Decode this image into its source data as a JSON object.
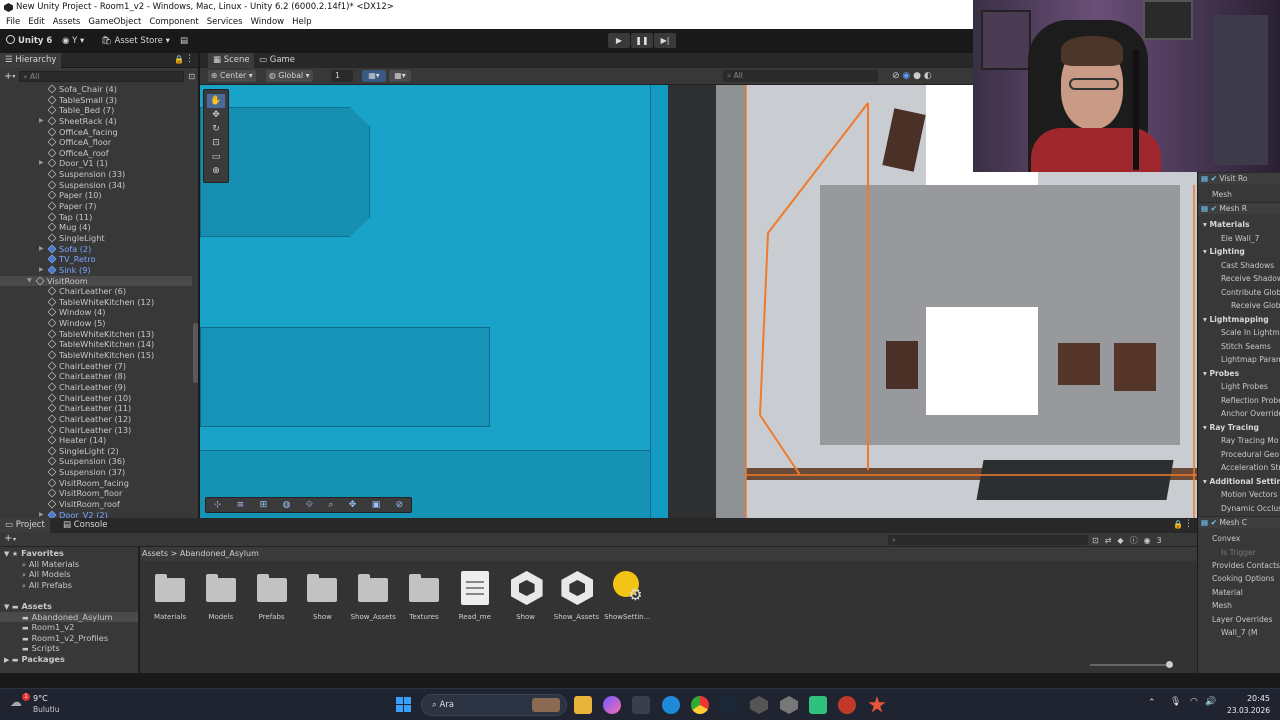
{
  "window": {
    "title": "New Unity Project - Room1_v2 - Windows, Mac, Linux - Unity 6.2 (6000.2.14f1)* <DX12>"
  },
  "menu": [
    "File",
    "Edit",
    "Assets",
    "GameObject",
    "Component",
    "Services",
    "Window",
    "Help"
  ],
  "toolbar": {
    "unity_label": "Unity 6",
    "account_label": "Y",
    "asset_store": "Asset Store",
    "play_icons": [
      "▶",
      "❚❚",
      "▶|"
    ]
  },
  "hierarchy": {
    "title": "Hierarchy",
    "search_placeholder": "All",
    "items": [
      {
        "label": "Sofa_Chair (4)",
        "indent": 1,
        "type": "obj"
      },
      {
        "label": "TableSmall (3)",
        "indent": 1,
        "type": "obj"
      },
      {
        "label": "Table_Bed (7)",
        "indent": 1,
        "type": "obj"
      },
      {
        "label": "SheetRack (4)",
        "indent": 1,
        "type": "obj",
        "arrow": true
      },
      {
        "label": "OfficeA_facing",
        "indent": 1,
        "type": "obj"
      },
      {
        "label": "OfficeA_floor",
        "indent": 1,
        "type": "obj"
      },
      {
        "label": "OfficeA_roof",
        "indent": 1,
        "type": "obj"
      },
      {
        "label": "Door_V1 (1)",
        "indent": 1,
        "type": "obj",
        "arrow": true
      },
      {
        "label": "Suspension (33)",
        "indent": 1,
        "type": "obj"
      },
      {
        "label": "Suspension (34)",
        "indent": 1,
        "type": "obj"
      },
      {
        "label": "Paper (10)",
        "indent": 1,
        "type": "obj"
      },
      {
        "label": "Paper (7)",
        "indent": 1,
        "type": "obj"
      },
      {
        "label": "Tap (11)",
        "indent": 1,
        "type": "obj"
      },
      {
        "label": "Mug (4)",
        "indent": 1,
        "type": "obj"
      },
      {
        "label": "SingleLight",
        "indent": 1,
        "type": "obj"
      },
      {
        "label": "Sofa (2)",
        "indent": 1,
        "type": "prefab",
        "arrow": true
      },
      {
        "label": "TV_Retro",
        "indent": 1,
        "type": "prefab"
      },
      {
        "label": "Sink (9)",
        "indent": 1,
        "type": "prefab",
        "arrow": true
      },
      {
        "label": "VisitRoom",
        "indent": 0,
        "type": "obj",
        "arrow": true,
        "selected": true
      },
      {
        "label": "ChairLeather (6)",
        "indent": 1,
        "type": "obj"
      },
      {
        "label": "TableWhiteKitchen (12)",
        "indent": 1,
        "type": "obj"
      },
      {
        "label": "Window (4)",
        "indent": 1,
        "type": "obj"
      },
      {
        "label": "Window (5)",
        "indent": 1,
        "type": "obj"
      },
      {
        "label": "TableWhiteKitchen (13)",
        "indent": 1,
        "type": "obj"
      },
      {
        "label": "TableWhiteKitchen (14)",
        "indent": 1,
        "type": "obj"
      },
      {
        "label": "TableWhiteKitchen (15)",
        "indent": 1,
        "type": "obj"
      },
      {
        "label": "ChairLeather (7)",
        "indent": 1,
        "type": "obj"
      },
      {
        "label": "ChairLeather (8)",
        "indent": 1,
        "type": "obj"
      },
      {
        "label": "ChairLeather (9)",
        "indent": 1,
        "type": "obj"
      },
      {
        "label": "ChairLeather (10)",
        "indent": 1,
        "type": "obj"
      },
      {
        "label": "ChairLeather (11)",
        "indent": 1,
        "type": "obj"
      },
      {
        "label": "ChairLeather (12)",
        "indent": 1,
        "type": "obj"
      },
      {
        "label": "ChairLeather (13)",
        "indent": 1,
        "type": "obj"
      },
      {
        "label": "Heater (14)",
        "indent": 1,
        "type": "obj"
      },
      {
        "label": "SingleLight (2)",
        "indent": 1,
        "type": "obj"
      },
      {
        "label": "Suspension (36)",
        "indent": 1,
        "type": "obj"
      },
      {
        "label": "Suspension (37)",
        "indent": 1,
        "type": "obj"
      },
      {
        "label": "VisitRoom_facing",
        "indent": 1,
        "type": "obj"
      },
      {
        "label": "VisitRoom_floor",
        "indent": 1,
        "type": "obj"
      },
      {
        "label": "VisitRoom_roof",
        "indent": 1,
        "type": "obj"
      },
      {
        "label": "Door_V2 (2)",
        "indent": 1,
        "type": "prefab",
        "arrow": true
      }
    ]
  },
  "scene": {
    "tabs": [
      "Scene",
      "Game"
    ],
    "pivot": "Center",
    "space": "Global",
    "grid_value": "1",
    "search_placeholder": "All"
  },
  "project": {
    "tabs": [
      "Project",
      "Console"
    ],
    "breadcrumb": [
      "Assets",
      "Abandoned_Asylum"
    ],
    "tree": [
      {
        "label": "Favorites",
        "indent": 0,
        "bold": true
      },
      {
        "label": "All Materials",
        "indent": 2
      },
      {
        "label": "All Models",
        "indent": 2
      },
      {
        "label": "All Prefabs",
        "indent": 2
      },
      {
        "label": "",
        "indent": 0
      },
      {
        "label": "Assets",
        "indent": 0,
        "bold": true
      },
      {
        "label": "Abandoned_Asylum",
        "indent": 2,
        "selected": true
      },
      {
        "label": "Room1_v2",
        "indent": 2
      },
      {
        "label": "Room1_v2_Profiles",
        "indent": 2
      },
      {
        "label": "Scripts",
        "indent": 2
      },
      {
        "label": "Packages",
        "indent": 0,
        "bold": true
      }
    ],
    "assets": [
      {
        "label": "Materials",
        "kind": "folder"
      },
      {
        "label": "Models",
        "kind": "folder"
      },
      {
        "label": "Prefabs",
        "kind": "folder"
      },
      {
        "label": "Show",
        "kind": "folder"
      },
      {
        "label": "Show_Assets",
        "kind": "folder"
      },
      {
        "label": "Textures",
        "kind": "folder"
      },
      {
        "label": "Read_me",
        "kind": "doc"
      },
      {
        "label": "Show",
        "kind": "unity"
      },
      {
        "label": "Show_Assets",
        "kind": "unity"
      },
      {
        "label": "ShowSettin...",
        "kind": "settings"
      }
    ],
    "count_badge": "3"
  },
  "inspector": {
    "rows": [
      {
        "label": "Visit Ro",
        "kind": "comp"
      },
      {
        "label": "Mesh",
        "kind": "plain"
      },
      {
        "label": "Mesh R",
        "kind": "comp"
      },
      {
        "label": "Materials",
        "kind": "section"
      },
      {
        "label": "Ele Wall_7",
        "kind": "sub"
      },
      {
        "label": "Lighting",
        "kind": "section"
      },
      {
        "label": "Cast Shadows",
        "kind": "sub"
      },
      {
        "label": "Receive Shadow",
        "kind": "sub"
      },
      {
        "label": "Contribute Globa",
        "kind": "sub"
      },
      {
        "label": "Receive Glob",
        "kind": "sub2"
      },
      {
        "label": "Lightmapping",
        "kind": "section"
      },
      {
        "label": "Scale In Lightm",
        "kind": "sub"
      },
      {
        "label": "Stitch Seams",
        "kind": "sub"
      },
      {
        "label": "Lightmap Param",
        "kind": "sub"
      },
      {
        "label": "Probes",
        "kind": "section"
      },
      {
        "label": "Light Probes",
        "kind": "sub"
      },
      {
        "label": "Reflection Probe",
        "kind": "sub"
      },
      {
        "label": "Anchor Override",
        "kind": "sub"
      },
      {
        "label": "Ray Tracing",
        "kind": "section"
      },
      {
        "label": "Ray Tracing Mo",
        "kind": "sub"
      },
      {
        "label": "Procedural Geo",
        "kind": "sub"
      },
      {
        "label": "Acceleration Str",
        "kind": "sub"
      },
      {
        "label": "Additional Setting",
        "kind": "section"
      },
      {
        "label": "Motion Vectors",
        "kind": "sub"
      },
      {
        "label": "Dynamic Occlus",
        "kind": "sub"
      },
      {
        "label": "Mesh C",
        "kind": "comp"
      },
      {
        "label": "Convex",
        "kind": "plain"
      },
      {
        "label": "Is Trigger",
        "kind": "dim"
      },
      {
        "label": "Provides Contacts",
        "kind": "plain"
      },
      {
        "label": "Cooking Options",
        "kind": "plain"
      },
      {
        "label": "Material",
        "kind": "plain"
      },
      {
        "label": "Mesh",
        "kind": "plain"
      },
      {
        "label": "Layer Overrides",
        "kind": "plain"
      },
      {
        "label": "Wall_7 (M",
        "kind": "sub"
      }
    ]
  },
  "taskbar": {
    "weather_temp": "9°C",
    "weather_desc": "Bulutlu",
    "search_label": "Ara",
    "time": "20:45",
    "date": "23.03.2026"
  },
  "colors": {
    "accent": "#3a72c9",
    "selection_orange": "#f07a2a",
    "scene_blue": "#1aa3c9"
  }
}
